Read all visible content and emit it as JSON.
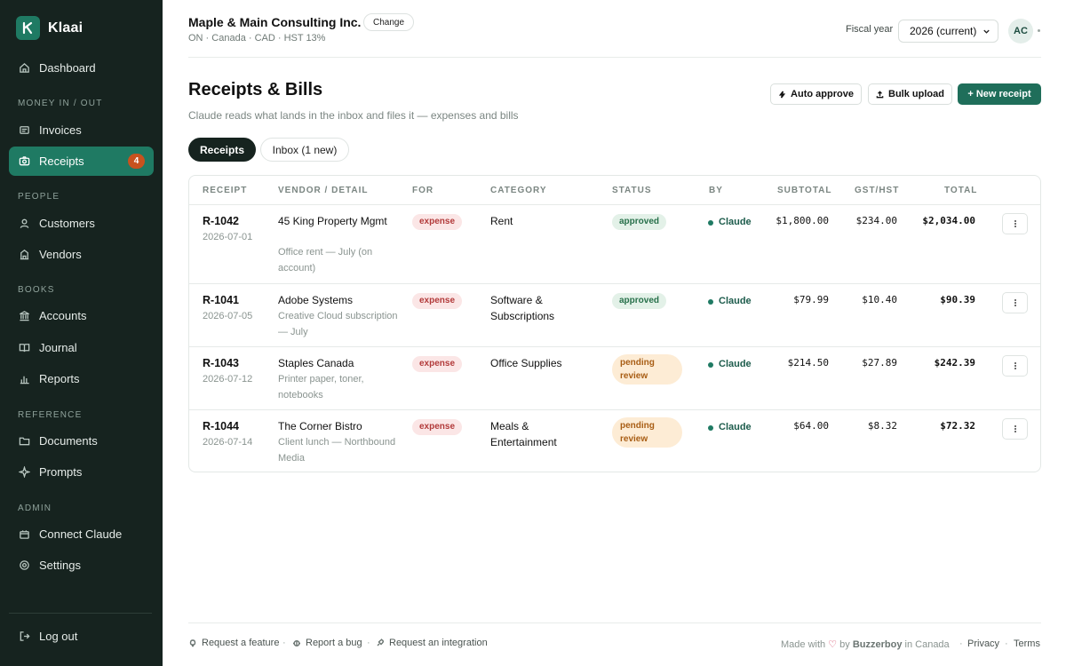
{
  "app": {
    "name": "Klaai",
    "logo_letter": "K",
    "accent": "#1f7a63"
  },
  "sidebar": {
    "dashboard": "Dashboard",
    "sections": {
      "money": "MONEY IN / OUT",
      "people": "PEOPLE",
      "books": "BOOKS",
      "reference": "REFERENCE",
      "admin": "ADMIN"
    },
    "items": {
      "invoices": "Invoices",
      "receipts": "Receipts",
      "receipts_badge": "4",
      "customers": "Customers",
      "vendors": "Vendors",
      "accounts": "Accounts",
      "journal": "Journal",
      "reports": "Reports",
      "documents": "Documents",
      "prompts": "Prompts",
      "connect": "Connect Claude",
      "settings": "Settings"
    },
    "logout": "Log out"
  },
  "header": {
    "org_name": "Maple & Main Consulting Inc.",
    "change_label": "Change",
    "org_meta": "ON · Canada · CAD · HST 13%",
    "fiscal_label": "Fiscal year",
    "fiscal_value": "2026 (current)",
    "avatar_initials": "AC"
  },
  "page": {
    "title": "Receipts & Bills",
    "subtitle": "Claude reads what lands in the inbox and files it — expenses and bills",
    "auto_approve": "Auto approve",
    "bulk_upload": "Bulk upload",
    "new_receipt": "+ New receipt",
    "tabs": {
      "receipts": "Receipts",
      "inbox": "Inbox (1 new)"
    }
  },
  "table": {
    "headers": {
      "receipt": "RECEIPT",
      "vendor": "VENDOR / DETAIL",
      "for": "FOR",
      "category": "CATEGORY",
      "status": "STATUS",
      "by": "BY",
      "subtotal": "SUBTOTAL",
      "tax": "GST/HST",
      "total": "TOTAL"
    },
    "rows": [
      {
        "id": "R-1042",
        "date": "2026-07-01",
        "vendor": "45 King Property Mgmt",
        "detail": "Office rent — July (on account)",
        "for": "expense",
        "category": "Rent",
        "status": "approved",
        "by": "Claude",
        "subtotal": "$1,800.00",
        "tax": "$234.00",
        "total": "$2,034.00"
      },
      {
        "id": "R-1041",
        "date": "2026-07-05",
        "vendor": "Adobe Systems",
        "detail": "Creative Cloud subscription — July",
        "for": "expense",
        "category": "Software & Subscriptions",
        "status": "approved",
        "by": "Claude",
        "subtotal": "$79.99",
        "tax": "$10.40",
        "total": "$90.39"
      },
      {
        "id": "R-1043",
        "date": "2026-07-12",
        "vendor": "Staples Canada",
        "detail": "Printer paper, toner, notebooks",
        "for": "expense",
        "category": "Office Supplies",
        "status": "pending review",
        "by": "Claude",
        "subtotal": "$214.50",
        "tax": "$27.89",
        "total": "$242.39"
      },
      {
        "id": "R-1044",
        "date": "2026-07-14",
        "vendor": "The Corner Bistro",
        "detail": "Client lunch — Northbound Media",
        "for": "expense",
        "category": "Meals & Entertainment",
        "status": "pending review",
        "by": "Claude",
        "subtotal": "$64.00",
        "tax": "$8.32",
        "total": "$72.32"
      }
    ]
  },
  "footer": {
    "request_feature": "Request a feature",
    "report_bug": "Report a bug",
    "request_integration": "Request an integration",
    "sep": "·",
    "made_with": "Made with",
    "by": "by",
    "company": "Buzzerboy",
    "in_canada": "in Canada",
    "privacy": "Privacy",
    "terms": "Terms"
  }
}
